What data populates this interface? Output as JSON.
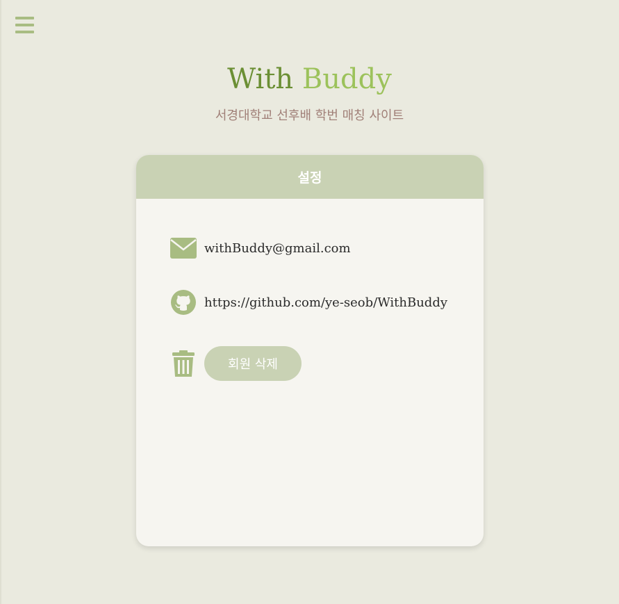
{
  "app": {
    "brand_part1": "With",
    "brand_part2": "Buddy",
    "subtitle": "서경대학교 선후배 학번 매칭 사이트"
  },
  "nav": {
    "menu_icon": "hamburger-menu-icon"
  },
  "settings_card": {
    "title": "설정",
    "email": {
      "icon": "envelope-icon",
      "value": "withBuddy@gmail.com"
    },
    "github": {
      "icon": "github-icon",
      "value": "https://github.com/ye-seob/WithBuddy"
    },
    "delete_account": {
      "icon": "trash-icon",
      "button_label": "회원 삭제"
    }
  },
  "colors": {
    "background": "#eaeadf",
    "accent": "#a8bc82",
    "brand_dark": "#6b8f34",
    "brand_light": "#9cc25b",
    "card_header": "#c9d2b4",
    "subtitle": "#a07f77"
  }
}
